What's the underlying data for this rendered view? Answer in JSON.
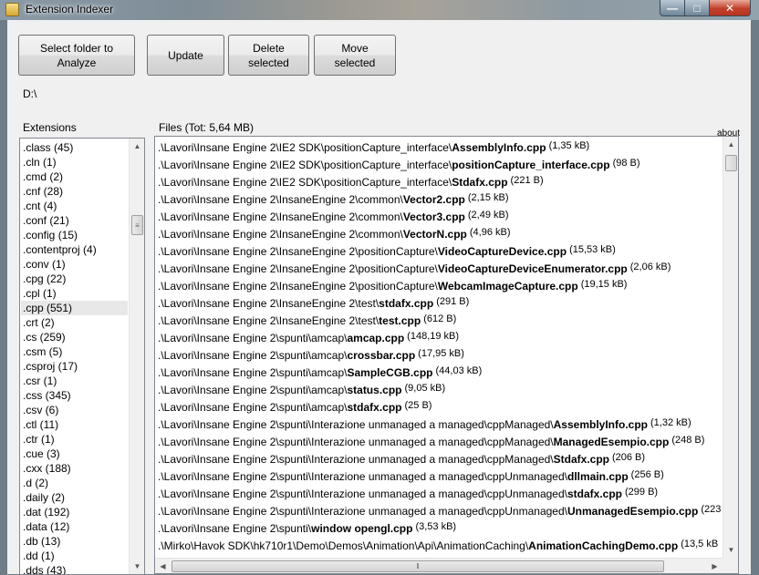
{
  "window": {
    "title": "Extension Indexer",
    "min_glyph": "—",
    "max_glyph": "□",
    "close_glyph": "✕"
  },
  "toolbar": {
    "select_folder_label": "Select folder to\nAnalyze",
    "update_label": "Update",
    "delete_label": "Delete\nselected",
    "move_label": "Move\nselected"
  },
  "folder_path": "D:\\",
  "extensions": {
    "label": "Extensions",
    "selected_index": 11,
    "items": [
      ".class (45)",
      ".cln (1)",
      ".cmd (2)",
      ".cnf (28)",
      ".cnt (4)",
      ".conf (21)",
      ".config (15)",
      ".contentproj (4)",
      ".conv (1)",
      ".cpg (22)",
      ".cpl (1)",
      ".cpp (551)",
      ".crt (2)",
      ".cs (259)",
      ".csm (5)",
      ".csproj (17)",
      ".csr (1)",
      ".css (345)",
      ".csv (6)",
      ".ctl (11)",
      ".ctr (1)",
      ".cue (3)",
      ".cxx (188)",
      ".d (2)",
      ".daily (2)",
      ".dat (192)",
      ".data (12)",
      ".db (13)",
      ".dd (1)",
      ".dds (43)"
    ]
  },
  "files": {
    "label": "Files  (Tot: 5,64 MB)",
    "about_label": "about",
    "rows": [
      {
        "path": ".\\Lavori\\Insane Engine 2\\IE2 SDK\\positionCapture_interface\\",
        "name": "AssemblyInfo.cpp",
        "size": "(1,35 kB)"
      },
      {
        "path": ".\\Lavori\\Insane Engine 2\\IE2 SDK\\positionCapture_interface\\",
        "name": "positionCapture_interface.cpp",
        "size": "(98 B)"
      },
      {
        "path": ".\\Lavori\\Insane Engine 2\\IE2 SDK\\positionCapture_interface\\",
        "name": "Stdafx.cpp",
        "size": "(221 B)"
      },
      {
        "path": ".\\Lavori\\Insane Engine 2\\InsaneEngine 2\\common\\",
        "name": "Vector2.cpp",
        "size": "(2,15 kB)"
      },
      {
        "path": ".\\Lavori\\Insane Engine 2\\InsaneEngine 2\\common\\",
        "name": "Vector3.cpp",
        "size": "(2,49 kB)"
      },
      {
        "path": ".\\Lavori\\Insane Engine 2\\InsaneEngine 2\\common\\",
        "name": "VectorN.cpp",
        "size": "(4,96 kB)"
      },
      {
        "path": ".\\Lavori\\Insane Engine 2\\InsaneEngine 2\\positionCapture\\",
        "name": "VideoCaptureDevice.cpp",
        "size": "(15,53 kB)"
      },
      {
        "path": ".\\Lavori\\Insane Engine 2\\InsaneEngine 2\\positionCapture\\",
        "name": "VideoCaptureDeviceEnumerator.cpp",
        "size": "(2,06 kB)"
      },
      {
        "path": ".\\Lavori\\Insane Engine 2\\InsaneEngine 2\\positionCapture\\",
        "name": "WebcamImageCapture.cpp",
        "size": "(19,15 kB)"
      },
      {
        "path": ".\\Lavori\\Insane Engine 2\\InsaneEngine 2\\test\\",
        "name": "stdafx.cpp",
        "size": "(291 B)"
      },
      {
        "path": ".\\Lavori\\Insane Engine 2\\InsaneEngine 2\\test\\",
        "name": "test.cpp",
        "size": "(612 B)"
      },
      {
        "path": ".\\Lavori\\Insane Engine 2\\spunti\\amcap\\",
        "name": "amcap.cpp",
        "size": "(148,19 kB)"
      },
      {
        "path": ".\\Lavori\\Insane Engine 2\\spunti\\amcap\\",
        "name": "crossbar.cpp",
        "size": "(17,95 kB)"
      },
      {
        "path": ".\\Lavori\\Insane Engine 2\\spunti\\amcap\\",
        "name": "SampleCGB.cpp",
        "size": "(44,03 kB)"
      },
      {
        "path": ".\\Lavori\\Insane Engine 2\\spunti\\amcap\\",
        "name": "status.cpp",
        "size": "(9,05 kB)"
      },
      {
        "path": ".\\Lavori\\Insane Engine 2\\spunti\\amcap\\",
        "name": "stdafx.cpp",
        "size": "(25 B)"
      },
      {
        "path": ".\\Lavori\\Insane Engine 2\\spunti\\Interazione unmanaged a managed\\cppManaged\\",
        "name": "AssemblyInfo.cpp",
        "size": "(1,32 kB)"
      },
      {
        "path": ".\\Lavori\\Insane Engine 2\\spunti\\Interazione unmanaged a managed\\cppManaged\\",
        "name": "ManagedEsempio.cpp",
        "size": "(248 B)"
      },
      {
        "path": ".\\Lavori\\Insane Engine 2\\spunti\\Interazione unmanaged a managed\\cppManaged\\",
        "name": "Stdafx.cpp",
        "size": "(206 B)"
      },
      {
        "path": ".\\Lavori\\Insane Engine 2\\spunti\\Interazione unmanaged a managed\\cppUnmanaged\\",
        "name": "dllmain.cpp",
        "size": "(256 B)"
      },
      {
        "path": ".\\Lavori\\Insane Engine 2\\spunti\\Interazione unmanaged a managed\\cppUnmanaged\\",
        "name": "stdafx.cpp",
        "size": "(299 B)"
      },
      {
        "path": ".\\Lavori\\Insane Engine 2\\spunti\\Interazione unmanaged a managed\\cppUnmanaged\\",
        "name": "UnmanagedEsempio.cpp",
        "size": "(223"
      },
      {
        "path": ".\\Lavori\\Insane Engine 2\\spunti\\",
        "name": "window opengl.cpp",
        "size": "(3,53 kB)"
      },
      {
        "path": ".\\Mirko\\Havok SDK\\hk710r1\\Demo\\Demos\\Animation\\Api\\AnimationCaching\\",
        "name": "AnimationCachingDemo.cpp",
        "size": "(13,5 kB"
      }
    ]
  },
  "scroll_glyphs": {
    "up": "▲",
    "down": "▼",
    "left": "◀",
    "right": "▶",
    "grip_v": "≡",
    "grip_h": "‖"
  }
}
